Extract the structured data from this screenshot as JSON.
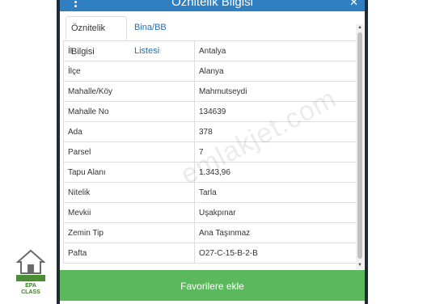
{
  "header": {
    "title": "Öznitelik Bilgisi"
  },
  "tabs": [
    {
      "label": "Öznitelik Bilgisi",
      "active": true
    },
    {
      "label": "Bina/BB Listesi",
      "active": false
    }
  ],
  "rows": [
    {
      "key": "İl",
      "value": "Antalya"
    },
    {
      "key": "İlçe",
      "value": "Alanya"
    },
    {
      "key": "Mahalle/Köy",
      "value": "Mahmutseydi"
    },
    {
      "key": "Mahalle No",
      "value": "134639"
    },
    {
      "key": "Ada",
      "value": "378"
    },
    {
      "key": "Parsel",
      "value": "7"
    },
    {
      "key": "Tapu Alanı",
      "value": "1.343,96"
    },
    {
      "key": "Nitelik",
      "value": "Tarla"
    },
    {
      "key": "Mevkii",
      "value": "Uşakpınar"
    },
    {
      "key": "Zemin Tip",
      "value": "Ana Taşınmaz"
    },
    {
      "key": "Pafta",
      "value": "O27-C-15-B-2-B"
    }
  ],
  "favorites_button": {
    "label": "Favorilere ekle"
  },
  "watermark": "emlakjet.com",
  "logo": {
    "text": "EPA",
    "subtext": "CLASS"
  },
  "colors": {
    "header": "#2f7fc1",
    "button": "#5cb85c",
    "link": "#2a6fb0"
  }
}
